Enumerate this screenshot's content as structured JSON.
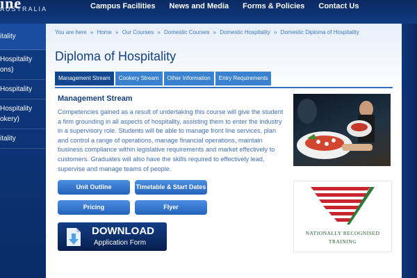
{
  "brand": {
    "logo_fragment": "ine",
    "logo_subtitle": "AUSTRALIA"
  },
  "topnav": {
    "items": [
      {
        "label": "Campus Facilities"
      },
      {
        "label": "News and Media"
      },
      {
        "label": "Forms & Policies"
      },
      {
        "label": "Contact Us"
      }
    ]
  },
  "sidebar": {
    "items": [
      {
        "label": "itality"
      },
      {
        "label": "Hospitality\nons)"
      },
      {
        "label": "Hospitality"
      },
      {
        "label": "Hospitality\nokery)"
      },
      {
        "label": "itality"
      }
    ]
  },
  "breadcrumb": {
    "items": [
      {
        "label": "You are here"
      },
      {
        "label": "Home"
      },
      {
        "label": "Our Courses"
      },
      {
        "label": "Domestic Courses"
      },
      {
        "label": "Domestic Hospitality"
      },
      {
        "label": "Domestic Diploma of Hospitality"
      }
    ],
    "separator": "»"
  },
  "page": {
    "title": "Diploma of Hospitality"
  },
  "tabs": [
    {
      "label": "Management Stream",
      "active": true
    },
    {
      "label": "Cookery Stream",
      "active": false
    },
    {
      "label": "Other Information",
      "active": false
    },
    {
      "label": "Entry Requirements",
      "active": false
    }
  ],
  "content": {
    "section_title": "Management Stream",
    "description": "Competencies gained as a result of undertaking this course will give the student a firm grounding in all aspects of hospitality, assisting them to enter the industry in a supervisory role. Students will be able to manage front line services, plan and control a range of operations, manage financial operations, maintain business compliance within legislative requirements and market effectively to customers. Graduates will also have the skills required to effectively lead, supervise and manage teams of people."
  },
  "buttons": {
    "unit_outline": "Unit Outline",
    "timetable": "Timetable & Start Dates",
    "pricing": "Pricing",
    "flyer": "Flyer"
  },
  "download": {
    "title": "DOWNLOAD",
    "subtitle": "Application Form"
  },
  "badge": {
    "line1": "NATIONALLY RECOGNISED",
    "line2": "TRAINING"
  },
  "colors": {
    "nav_background": "#0b2a63",
    "tab_active": "#12468f",
    "tab_inactive": "#3a82cf",
    "button": "#2f72c8",
    "title_text": "#123f84",
    "body_text": "#3f6cae",
    "nrt_red": "#c9252f",
    "nrt_green": "#2f7a3a"
  }
}
